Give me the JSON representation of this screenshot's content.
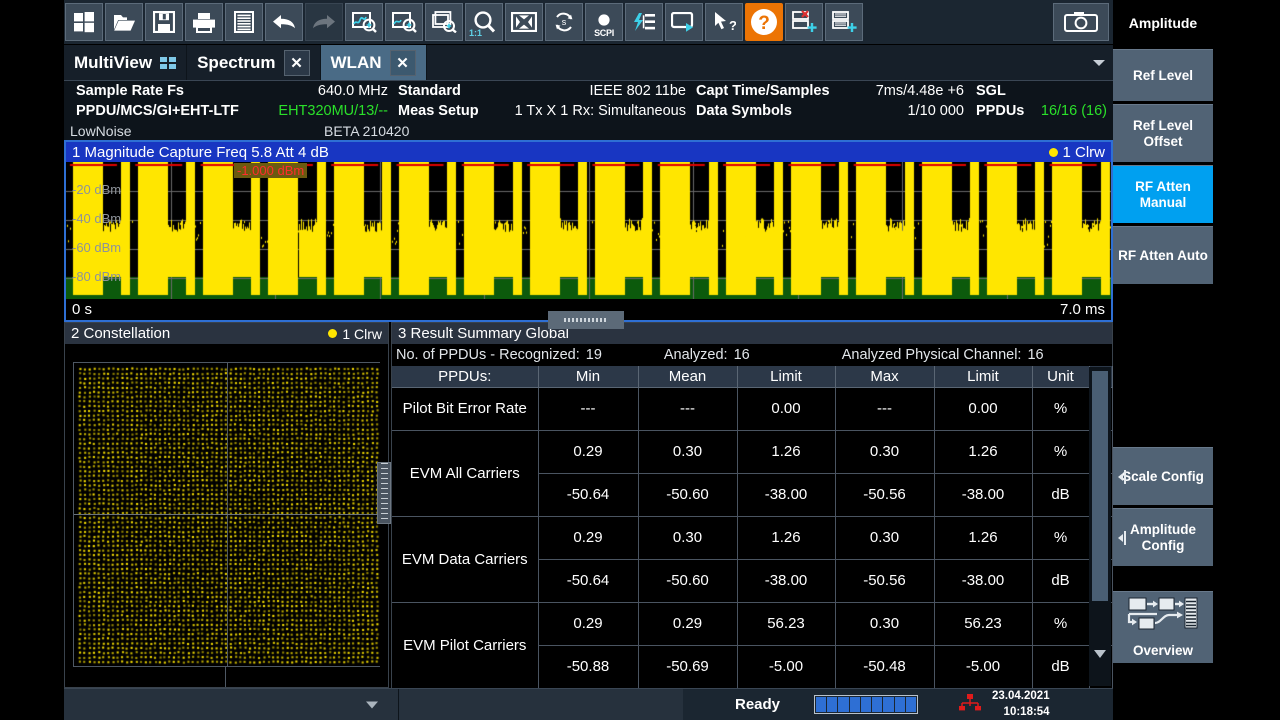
{
  "toolbar": {
    "buttons": [
      {
        "name": "windows-start-icon",
        "label": "Start"
      },
      {
        "name": "open-folder-icon",
        "label": "Open"
      },
      {
        "name": "save-floppy-icon",
        "label": "Save"
      },
      {
        "name": "print-icon",
        "label": "Print"
      },
      {
        "name": "report-icon",
        "label": "Report"
      },
      {
        "name": "undo-arrow-icon",
        "label": "Undo"
      },
      {
        "name": "redo-arrow-icon",
        "label": "Redo"
      },
      {
        "name": "zoom-trace-icon",
        "label": "Zoom Trace"
      },
      {
        "name": "zoom-in-icon",
        "label": "Zoom"
      },
      {
        "name": "multi-zoom-icon",
        "label": "Multi Zoom"
      },
      {
        "name": "zoom-one-to-one-icon",
        "label": "1:1",
        "badge": "1:1"
      },
      {
        "name": "fullscreen-icon",
        "label": "Full Screen"
      },
      {
        "name": "sequencer-icon",
        "label": "Sequencer"
      },
      {
        "name": "scpi-recorder-icon",
        "label": "SCPI",
        "badge": "SCPI"
      },
      {
        "name": "signal-generator-icon",
        "label": "Signal Generator"
      },
      {
        "name": "window-run-icon",
        "label": "Window"
      },
      {
        "name": "select-help-icon",
        "label": "Select Help"
      },
      {
        "name": "help-icon",
        "label": "Help"
      },
      {
        "name": "add-window-delete-icon",
        "label": "Add Window"
      },
      {
        "name": "add-window-icon",
        "label": "Add Window"
      }
    ],
    "camera": {
      "name": "screenshot-camera-icon",
      "label": "Print Screen"
    }
  },
  "tabs": {
    "multiview_label": "MultiView",
    "items": [
      {
        "label": "Spectrum",
        "active": false,
        "close": "✕"
      },
      {
        "label": "WLAN",
        "active": true,
        "close": "✕"
      }
    ]
  },
  "info_header": {
    "row1": [
      {
        "label": "Sample Rate Fs",
        "value": "640.0 MHz",
        "green": false
      },
      {
        "label": "Standard",
        "value": "IEEE 802 11be",
        "green": false
      },
      {
        "label": "Capt Time/Samples",
        "value": "7ms/4.48e +6",
        "green": false
      },
      {
        "label": "SGL",
        "value": "",
        "green": false
      }
    ],
    "row2": [
      {
        "label": "PPDU/MCS/GI+EHT-LTF",
        "value": "EHT320MU/13/--",
        "green": true
      },
      {
        "label": "Meas Setup",
        "value": "1 Tx X 1 Rx: Simultaneous",
        "green": false
      },
      {
        "label": "Data Symbols",
        "value": "1/10 000",
        "green": false
      },
      {
        "label": "PPDUs",
        "value": "16/16 (16)",
        "green": true
      }
    ],
    "row3_left": "LowNoise",
    "row3_mid": "BETA 210420"
  },
  "magnitude_window": {
    "title": "1 Magnitude Capture  Freq 5.8  Att 4 dB",
    "trace_label": "1 Clrw",
    "marker_label": "-1.000 dBm",
    "y_labels": [
      "-20 dBm",
      "-40 dBm",
      "-60 dBm",
      "-80 dBm"
    ],
    "x_start": "0 s",
    "x_stop": "7.0 ms",
    "trace_color": "#ffe600",
    "limit_color": "#e00000",
    "gate_color": "#0c5a0c"
  },
  "constellation_window": {
    "title": "2 Constellation",
    "trace_label": "1 Clrw",
    "point_color": "#ffe600"
  },
  "result_summary": {
    "title": "3 Result Summary Global",
    "counts": {
      "recognized_label": "No. of PPDUs - Recognized:",
      "recognized_value": "19",
      "analyzed_label": "Analyzed:",
      "analyzed_value": "16",
      "channel_label": "Analyzed Physical Channel:",
      "channel_value": "16"
    },
    "columns": [
      "PPDUs:",
      "Min",
      "Mean",
      "Limit",
      "Max",
      "Limit",
      "Unit"
    ],
    "rows": [
      {
        "name": "Pilot Bit Error Rate",
        "min": "---",
        "mean": "---",
        "limit1": "0.00",
        "max": "---",
        "limit2": "0.00",
        "unit": "%"
      },
      {
        "name": "EVM All Carriers",
        "min": "0.29",
        "mean": "0.30",
        "limit1": "1.26",
        "max": "0.30",
        "limit2": "1.26",
        "unit": "%"
      },
      {
        "name": "",
        "min": "-50.64",
        "mean": "-50.60",
        "limit1": "-38.00",
        "max": "-50.56",
        "limit2": "-38.00",
        "unit": "dB"
      },
      {
        "name": "EVM Data Carriers",
        "min": "0.29",
        "mean": "0.30",
        "limit1": "1.26",
        "max": "0.30",
        "limit2": "1.26",
        "unit": "%"
      },
      {
        "name": "",
        "min": "-50.64",
        "mean": "-50.60",
        "limit1": "-38.00",
        "max": "-50.56",
        "limit2": "-38.00",
        "unit": "dB"
      },
      {
        "name": "EVM Pilot Carriers",
        "min": "0.29",
        "mean": "0.29",
        "limit1": "56.23",
        "max": "0.30",
        "limit2": "56.23",
        "unit": "%"
      },
      {
        "name": "",
        "min": "-50.88",
        "mean": "-50.69",
        "limit1": "-5.00",
        "max": "-50.48",
        "limit2": "-5.00",
        "unit": "dB"
      }
    ]
  },
  "softkeys": {
    "title": "Amplitude",
    "items": [
      {
        "label": "Ref Level",
        "selected": false,
        "submenu": false
      },
      {
        "label": "Ref Level Offset",
        "selected": false,
        "submenu": false
      },
      {
        "label": "RF Atten Manual",
        "selected": true,
        "submenu": false
      },
      {
        "label": "RF Atten Auto",
        "selected": false,
        "submenu": false
      }
    ],
    "config_items": [
      {
        "label": "Scale Config",
        "submenu": true
      },
      {
        "label": "Amplitude Config",
        "submenu": true
      }
    ],
    "overview": {
      "label": "Overview",
      "icon": "overview-diagram-icon"
    }
  },
  "status_bar": {
    "status": "Ready",
    "date": "23.04.2021",
    "time": "10:18:54",
    "network_icon": "network-error-icon",
    "progress_blocks": 9
  },
  "colors": {
    "accent_blue": "#1836c2",
    "selected_softkey": "#00a0f0",
    "help_orange": "#ec7404",
    "trace_yellow": "#ffe600",
    "value_green": "#1fc41f"
  }
}
